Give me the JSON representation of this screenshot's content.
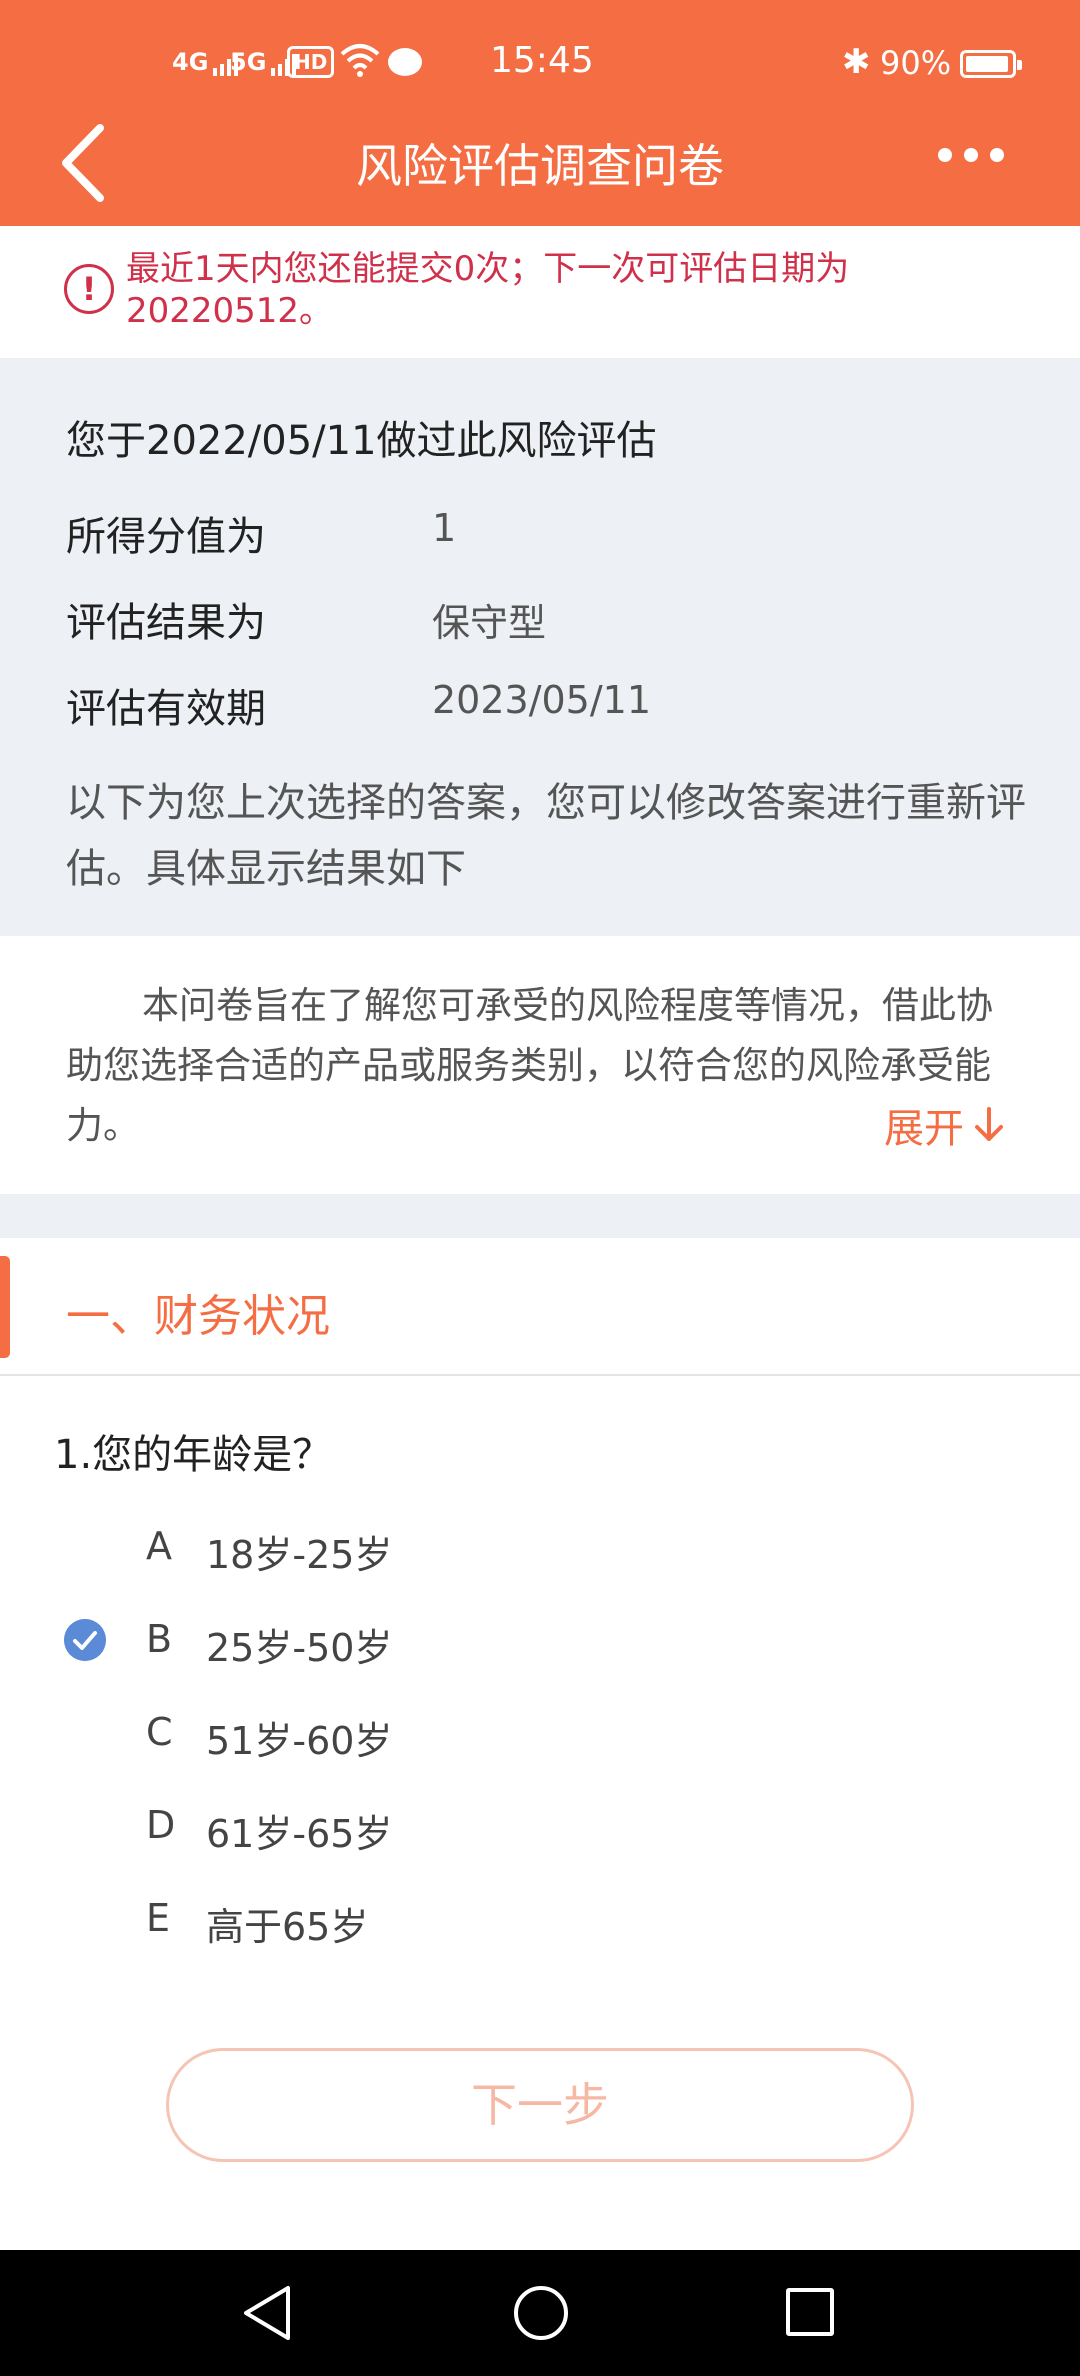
{
  "status_bar": {
    "network_1": "4G",
    "network_2": "5G",
    "hd": "HD",
    "time": "15:45",
    "battery": "90%"
  },
  "header": {
    "title": "风险评估调查问卷"
  },
  "warning": {
    "text": "最近1天内您还能提交0次；下一次可评估日期为20220512。"
  },
  "summary": {
    "heading": "您于2022/05/11做过此风险评估",
    "rows": [
      {
        "label": "所得分值为",
        "value": "1"
      },
      {
        "label": "评估结果为",
        "value": "保守型"
      },
      {
        "label": "评估有效期",
        "value": "2023/05/11"
      }
    ],
    "note": "以下为您上次选择的答案，您可以修改答案进行重新评估。具体显示结果如下"
  },
  "intro": {
    "text": "本问卷旨在了解您可承受的风险程度等情况，借此协助您选择合适的产品或服务类别，以符合您的风险承受能力。",
    "expand_label": "展开"
  },
  "section": {
    "title": "一、财务状况"
  },
  "question": {
    "text": "1.您的年龄是？",
    "options": [
      {
        "letter": "A",
        "text": "18岁-25岁",
        "selected": false
      },
      {
        "letter": "B",
        "text": "25岁-50岁",
        "selected": true
      },
      {
        "letter": "C",
        "text": "51岁-60岁",
        "selected": false
      },
      {
        "letter": "D",
        "text": "61岁-65岁",
        "selected": false
      },
      {
        "letter": "E",
        "text": "高于65岁",
        "selected": false
      }
    ]
  },
  "next_button": {
    "label": "下一步"
  },
  "colors": {
    "accent": "#F46D43",
    "warning": "#D0304A",
    "check": "#5B8BD6"
  }
}
